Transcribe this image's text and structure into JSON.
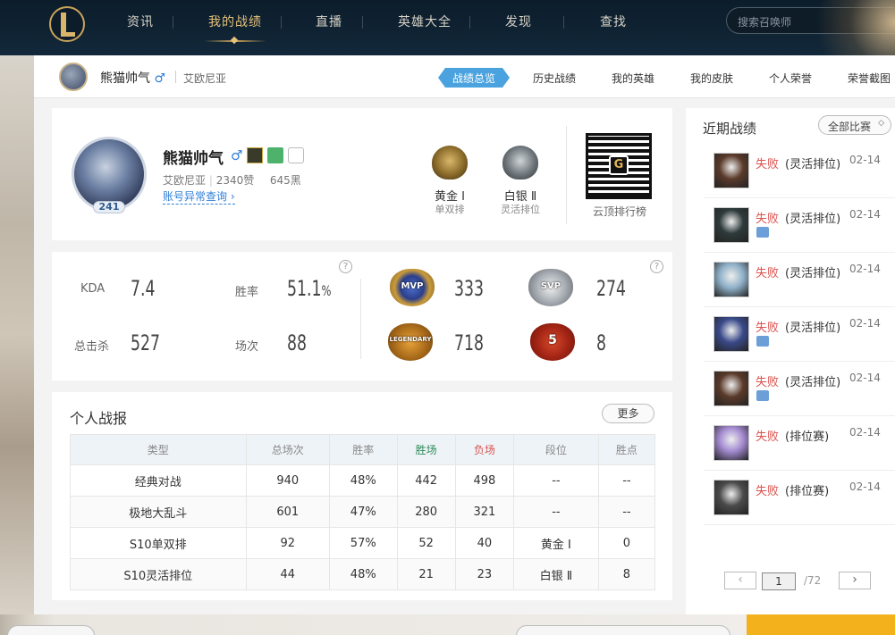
{
  "topnav": {
    "items": [
      "资讯",
      "我的战绩",
      "直播",
      "英雄大全",
      "发现",
      "查找"
    ],
    "active_index": 1,
    "search_placeholder": "搜索召唤师"
  },
  "subheader": {
    "name": "熊猫帅气",
    "gender": "♂",
    "server": "艾欧尼亚",
    "tabs": [
      "战绩总览",
      "历史战绩",
      "我的英雄",
      "我的皮肤",
      "个人荣誉",
      "荣誉截图"
    ],
    "active_tab": 0
  },
  "profile": {
    "level": "241",
    "name": "熊猫帅气",
    "gender": "♂",
    "server": "艾欧尼亚",
    "likes": "2340赞",
    "blacks": "645黑",
    "link": "账号异常查询",
    "ranks": [
      {
        "name": "黄金 Ⅰ",
        "queue": "单双排"
      },
      {
        "name": "白银 Ⅱ",
        "queue": "灵活排位"
      }
    ],
    "qr_label": "云顶排行榜",
    "qr_letter": "G"
  },
  "stats": {
    "kda_label": "KDA",
    "kda": "7.4",
    "winrate_label": "胜率",
    "winrate": "51.1",
    "winrate_unit": "%",
    "kills_label": "总击杀",
    "kills": "527",
    "games_label": "场次",
    "games": "88",
    "honors": [
      {
        "badge": "MVP",
        "count": "333"
      },
      {
        "badge": "SVP",
        "count": "274"
      },
      {
        "badge": "LEGENDARY",
        "count": "718"
      },
      {
        "badge": "5",
        "count": "8"
      }
    ],
    "help": "?"
  },
  "report": {
    "title": "个人战报",
    "more": "更多",
    "headers": [
      "类型",
      "总场次",
      "胜率",
      "胜场",
      "负场",
      "段位",
      "胜点"
    ],
    "rows": [
      [
        "经典对战",
        "940",
        "48%",
        "442",
        "498",
        "--",
        "--"
      ],
      [
        "极地大乱斗",
        "601",
        "47%",
        "280",
        "321",
        "--",
        "--"
      ],
      [
        "S10单双排",
        "92",
        "57%",
        "52",
        "40",
        "黄金 Ⅰ",
        "0"
      ],
      [
        "S10灵活排位",
        "44",
        "48%",
        "21",
        "23",
        "白银 Ⅱ",
        "8"
      ]
    ]
  },
  "recent": {
    "title": "近期战绩",
    "filter": "全部比赛",
    "matches": [
      {
        "result": "失败",
        "mode": "(灵活排位)",
        "date": "02-14",
        "has_image": false,
        "color": "#5a3a2a"
      },
      {
        "result": "失败",
        "mode": "(灵活排位)",
        "date": "02-14",
        "has_image": true,
        "color": "#2e3a3a"
      },
      {
        "result": "失败",
        "mode": "(灵活排位)",
        "date": "02-14",
        "has_image": false,
        "color": "#8fb0c8"
      },
      {
        "result": "失败",
        "mode": "(灵活排位)",
        "date": "02-14",
        "has_image": true,
        "color": "#3a4a8a"
      },
      {
        "result": "失败",
        "mode": "(灵活排位)",
        "date": "02-14",
        "has_image": true,
        "color": "#5a3a2a"
      },
      {
        "result": "失败",
        "mode": "(排位赛)",
        "date": "02-14",
        "has_image": false,
        "color": "#a38ad0"
      },
      {
        "result": "失败",
        "mode": "(排位赛)",
        "date": "02-14",
        "has_image": false,
        "color": "#4a4a4a"
      }
    ],
    "pager": {
      "prev": "‹",
      "page": "1",
      "total": "/72",
      "next": "›"
    }
  }
}
